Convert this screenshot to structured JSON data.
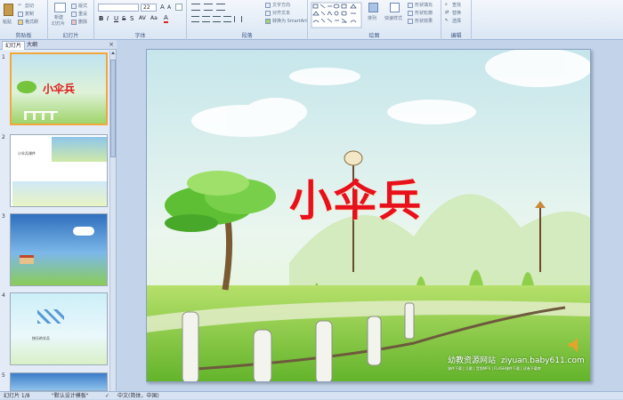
{
  "ribbon": {
    "clipboard": {
      "paste": "粘贴",
      "cut": "剪切",
      "copy": "复制",
      "format_painter": "格式刷",
      "label": "剪贴板"
    },
    "slides": {
      "new_slide": "新建",
      "new_slide2": "幻灯片",
      "layout": "版式",
      "reset": "重设",
      "delete": "删除",
      "label": "幻灯片"
    },
    "font": {
      "size": "22",
      "label": "字体"
    },
    "paragraph": {
      "text_direction": "文字方向",
      "align_text": "对齐文本",
      "smartart": "转换为 SmartArt",
      "label": "段落"
    },
    "drawing": {
      "arrange": "排列",
      "quick_styles": "快速样式",
      "shape_fill": "形状填充",
      "shape_outline": "形状轮廓",
      "shape_effects": "形状效果",
      "label": "绘图"
    },
    "editing": {
      "find": "查找",
      "replace": "替换",
      "select": "选择",
      "label": "编辑"
    }
  },
  "pane": {
    "tab_slides": "幻灯片",
    "tab_outline": "大纲",
    "close": "×",
    "thumbs": [
      {
        "num": "1",
        "title": "小伞兵"
      },
      {
        "num": "2",
        "caption": "小伞兵课件"
      },
      {
        "num": "3"
      },
      {
        "num": "4",
        "caption": "快乐的伞兵"
      },
      {
        "num": "5"
      }
    ]
  },
  "slide": {
    "title": "小伞兵",
    "site_name": "幼教资源网站",
    "site_url": "ziyuan.baby611.com",
    "site_sub": "课件下载 | 儿歌 | 音频MP3 | FLASH课件下载 | 试卷下载库"
  },
  "status": {
    "slide_count": "幻灯片 1/8",
    "theme": "\"默认设计模板\"",
    "lang": "中文(简体，中国)"
  }
}
